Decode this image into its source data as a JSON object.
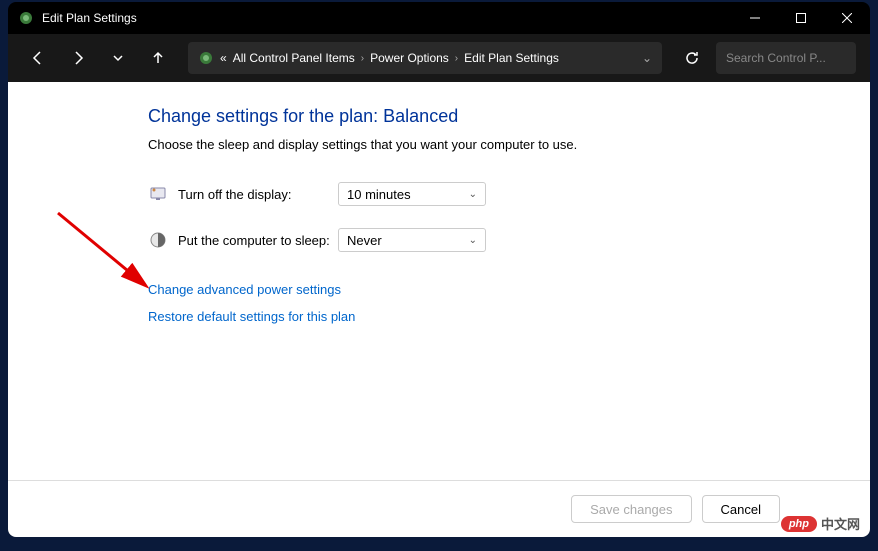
{
  "titlebar": {
    "title": "Edit Plan Settings"
  },
  "breadcrumb": {
    "prefix": "«",
    "items": [
      "All Control Panel Items",
      "Power Options",
      "Edit Plan Settings"
    ]
  },
  "search": {
    "placeholder": "Search Control P..."
  },
  "page": {
    "heading": "Change settings for the plan: Balanced",
    "subheading": "Choose the sleep and display settings that you want your computer to use."
  },
  "settings": {
    "display_off": {
      "label": "Turn off the display:",
      "value": "10 minutes"
    },
    "sleep": {
      "label": "Put the computer to sleep:",
      "value": "Never"
    }
  },
  "links": {
    "advanced": "Change advanced power settings",
    "restore": "Restore default settings for this plan"
  },
  "buttons": {
    "save": "Save changes",
    "cancel": "Cancel"
  },
  "watermark": {
    "badge": "php",
    "text": "中文网"
  }
}
